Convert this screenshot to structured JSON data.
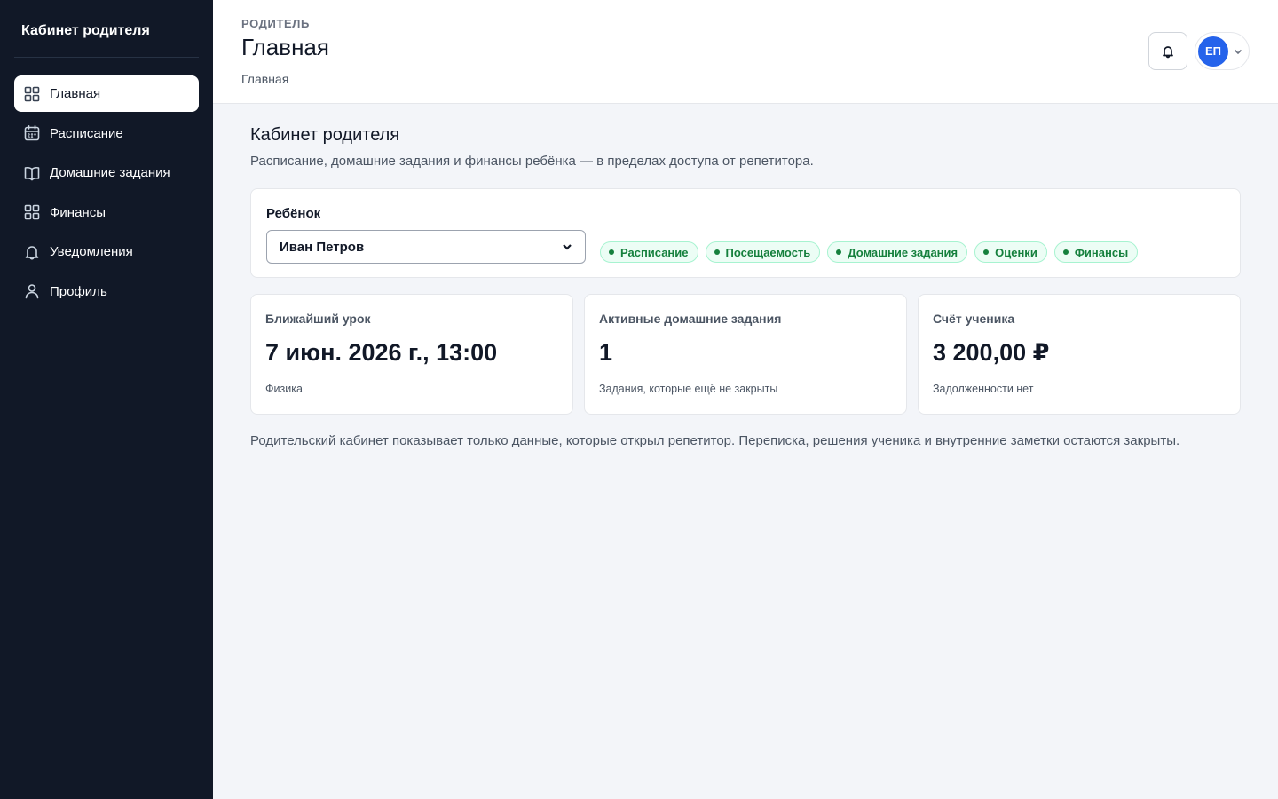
{
  "sidebar": {
    "brand": "Кабинет родителя",
    "items": [
      {
        "label": "Главная",
        "icon": "dashboard-icon",
        "active": true
      },
      {
        "label": "Расписание",
        "icon": "calendar-icon",
        "active": false
      },
      {
        "label": "Домашние задания",
        "icon": "book-icon",
        "active": false
      },
      {
        "label": "Финансы",
        "icon": "grid-icon",
        "active": false
      },
      {
        "label": "Уведомления",
        "icon": "bell-icon",
        "active": false
      },
      {
        "label": "Профиль",
        "icon": "user-icon",
        "active": false
      }
    ]
  },
  "header": {
    "role": "РОДИТЕЛЬ",
    "title": "Главная",
    "breadcrumb": "Главная",
    "notifications_icon": "bell-icon",
    "avatar_initials": "ЕП",
    "user_menu_icon": "chevron-down-icon"
  },
  "main": {
    "title": "Кабинет родителя",
    "subtitle": "Расписание, домашние задания и финансы ребёнка — в пределах доступа от репетитора.",
    "child": {
      "label": "Ребёнок",
      "selected": "Иван Петров",
      "permissions": [
        "Расписание",
        "Посещаемость",
        "Домашние задания",
        "Оценки",
        "Финансы"
      ]
    },
    "stats": [
      {
        "label": "Ближайший урок",
        "value": "7 июн. 2026 г., 13:00",
        "note": "Физика"
      },
      {
        "label": "Активные домашние задания",
        "value": "1",
        "note": "Задания, которые ещё не закрыты"
      },
      {
        "label": "Счёт ученика",
        "value": "3 200,00 ₽",
        "note": "Задолженности нет"
      }
    ],
    "footnote": "Родительский кабинет показывает только данные, которые открыл репетитор. Переписка, решения ученика и внутренние заметки остаются закрыты."
  },
  "colors": {
    "sidebar_bg": "#111827",
    "page_bg": "#f3f5f9",
    "accent": "#2563eb",
    "permission_green": "#15803d"
  }
}
